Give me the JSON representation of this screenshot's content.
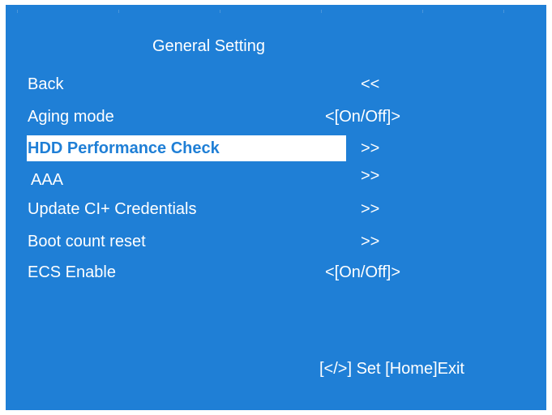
{
  "screen": {
    "title": "General Setting",
    "background_color": "#1f7fd6",
    "highlight_color": "#ffffff"
  },
  "menu": {
    "items": [
      {
        "label": "Back",
        "value": "<<"
      },
      {
        "label": "Aging mode",
        "value": "<[On/Off]>"
      },
      {
        "label": "HDD Performance Check",
        "value": ">>",
        "selected": true
      },
      {
        "label": "AAA",
        "value": ">>"
      },
      {
        "label": "Update CI+ Credentials",
        "value": ">>"
      },
      {
        "label": "Boot count reset",
        "value": ">>"
      },
      {
        "label": "ECS Enable",
        "value": "<[On/Off]>"
      }
    ]
  },
  "footer": {
    "hint": "[</>] Set [Home]Exit"
  }
}
